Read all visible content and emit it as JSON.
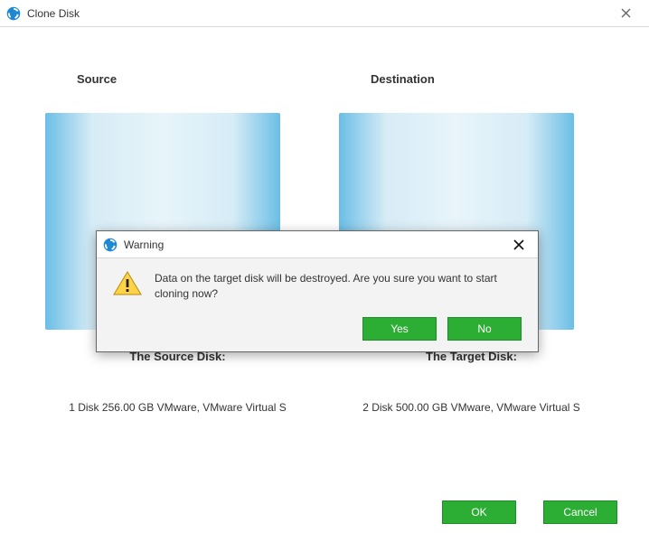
{
  "window": {
    "title": "Clone Disk"
  },
  "labels": {
    "source": "Source",
    "destination": "Destination",
    "source_disk_heading": "The Source Disk:",
    "target_disk_heading": "The Target Disk:"
  },
  "disks": {
    "source_desc": "1 Disk 256.00 GB VMware,  VMware Virtual S",
    "target_desc": "2 Disk 500.00 GB VMware,  VMware Virtual S"
  },
  "buttons": {
    "ok": "OK",
    "cancel": "Cancel"
  },
  "dialog": {
    "title": "Warning",
    "message": "Data on the target disk will be destroyed. Are you sure you want to start cloning now?",
    "yes": "Yes",
    "no": "No"
  },
  "colors": {
    "accent": "#2cae34"
  }
}
